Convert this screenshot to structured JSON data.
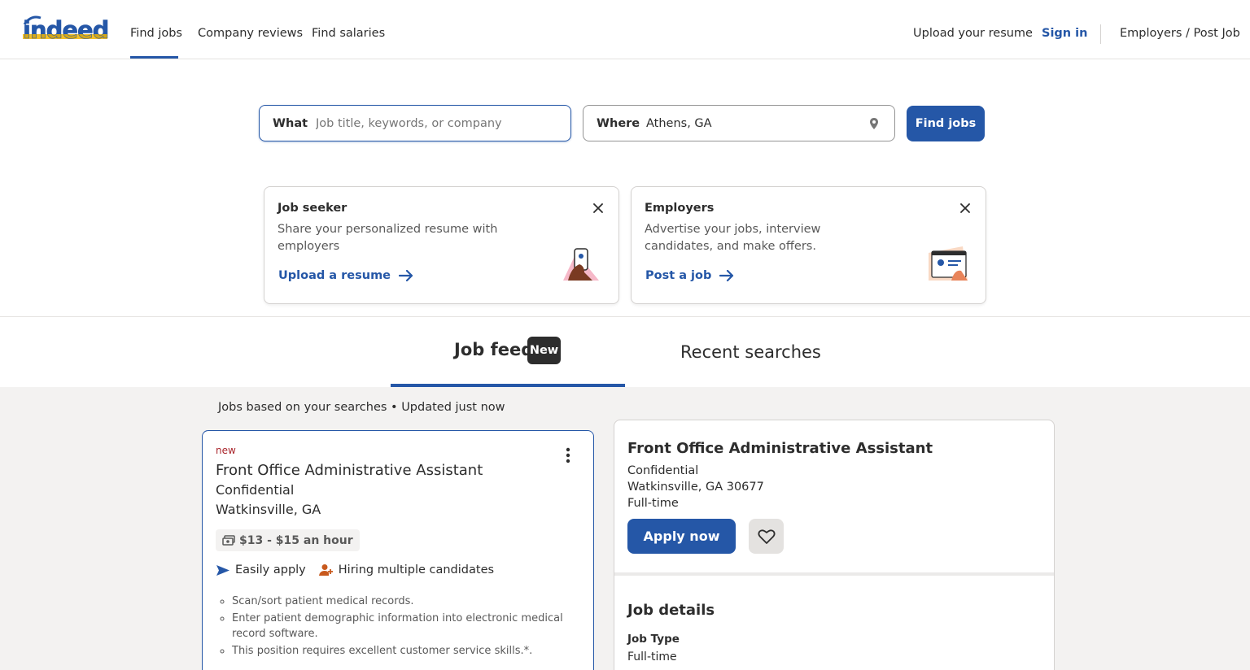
{
  "header": {
    "logo_text": "indeed",
    "nav": [
      "Find jobs",
      "Company reviews",
      "Find salaries"
    ],
    "upload_resume": "Upload your resume",
    "sign_in": "Sign in",
    "employers": "Employers / Post Job"
  },
  "search": {
    "what_label": "What",
    "what_placeholder": "Job title, keywords, or company",
    "what_value": "",
    "where_label": "Where",
    "where_value": "Athens, GA",
    "find_button": "Find jobs"
  },
  "promos": {
    "seeker": {
      "title": "Job seeker",
      "description": "Share your personalized resume with employers",
      "link": "Upload a resume"
    },
    "employer": {
      "title": "Employers",
      "description": "Advertise your jobs, interview candidates, and make offers.",
      "link": "Post a job"
    }
  },
  "tabs": {
    "feed": "Job feed",
    "feed_badge": "New",
    "recent": "Recent searches"
  },
  "feed": {
    "caption": "Jobs based on your searches • Updated just now",
    "job": {
      "tag": "new",
      "title": "Front Office Administrative Assistant",
      "company": "Confidential",
      "location": "Watkinsville, GA",
      "salary": "$13 - $15 an hour",
      "easily_apply": "Easily apply",
      "hiring": "Hiring multiple candidates",
      "snippet": [
        "Scan/sort patient medical records.",
        "Enter patient demographic information into electronic medical record software.",
        "This position requires excellent customer service skills.*."
      ]
    }
  },
  "detail": {
    "title": "Front Office Administrative Assistant",
    "company": "Confidential",
    "location": "Watkinsville, GA 30677",
    "type": "Full-time",
    "apply": "Apply now",
    "section": "Job details",
    "subhead": "Job Type",
    "subval": "Full-time"
  },
  "colors": {
    "brand_blue": "#2557a7",
    "logo_yellow": "#f2b500",
    "new_tag": "#a9252b",
    "feed_bg": "#f3f2f1"
  }
}
